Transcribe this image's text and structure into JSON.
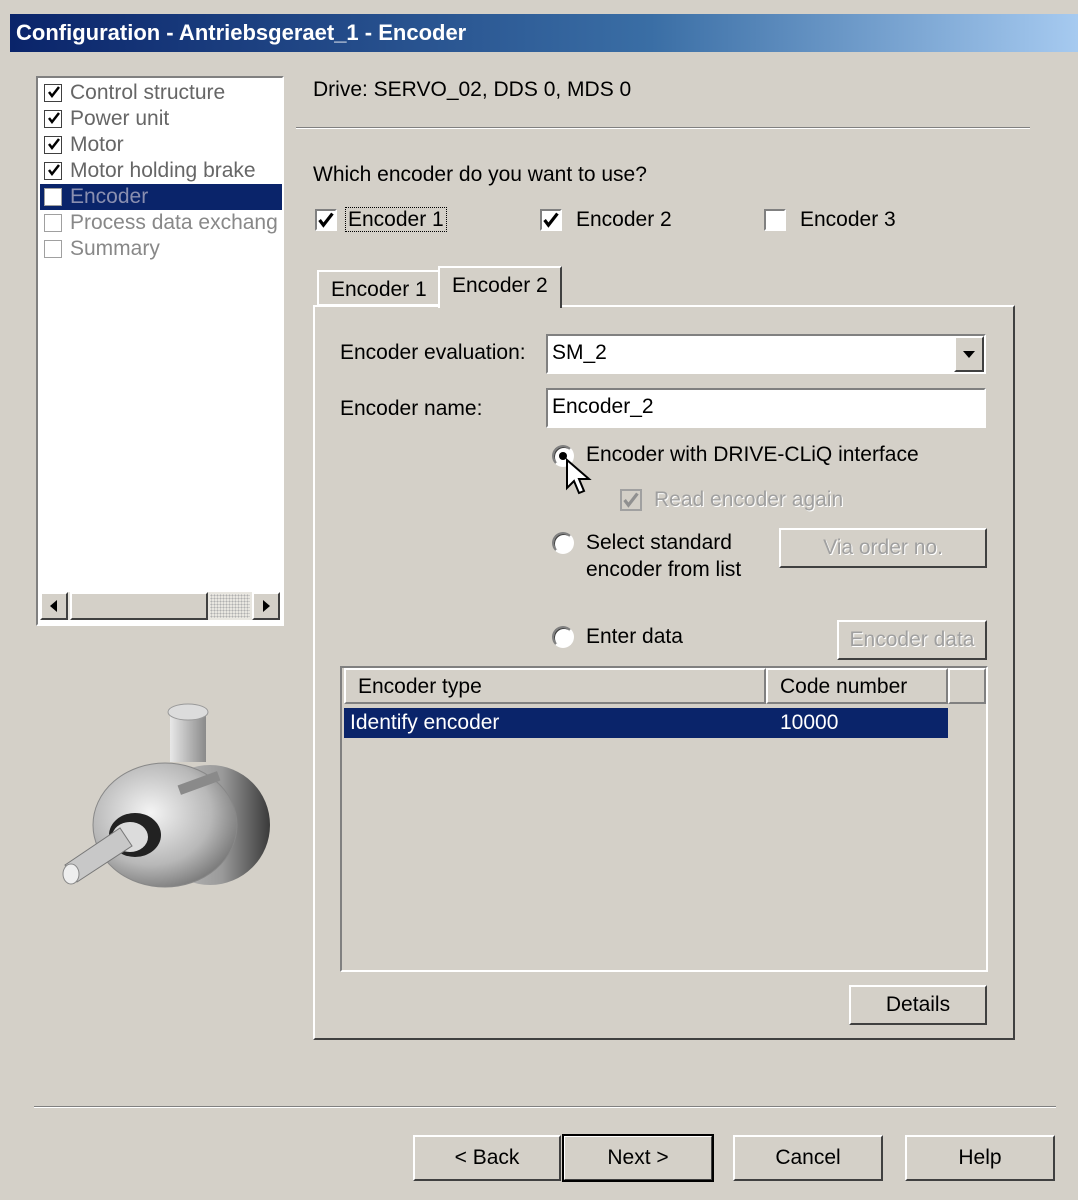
{
  "window": {
    "title": "Configuration - Antriebsgeraet_1 - Encoder"
  },
  "nav": {
    "items": [
      {
        "label": "Control structure",
        "checked": true,
        "selected": false
      },
      {
        "label": "Power unit",
        "checked": true,
        "selected": false
      },
      {
        "label": "Motor",
        "checked": true,
        "selected": false
      },
      {
        "label": "Motor holding brake",
        "checked": true,
        "selected": false
      },
      {
        "label": "Encoder",
        "checked": false,
        "selected": true
      },
      {
        "label": "Process data exchang",
        "checked": false,
        "selected": false
      },
      {
        "label": "Summary",
        "checked": false,
        "selected": false
      }
    ]
  },
  "drive": {
    "label": "Drive: SERVO_02, DDS 0, MDS 0"
  },
  "encoder_choice": {
    "question": "Which encoder do you want to use?",
    "options": [
      {
        "label": "Encoder 1",
        "checked": true
      },
      {
        "label": "Encoder 2",
        "checked": true
      },
      {
        "label": "Encoder 3",
        "checked": false
      }
    ]
  },
  "tabs": [
    {
      "label": "Encoder 1",
      "active": false
    },
    {
      "label": "Encoder 2",
      "active": true
    }
  ],
  "panel": {
    "evaluation_label": "Encoder evaluation:",
    "evaluation_value": "SM_2",
    "name_label": "Encoder name:",
    "name_value": "Encoder_2",
    "radio_drivecliq": "Encoder with DRIVE-CLiQ interface",
    "read_again": "Read encoder again",
    "radio_standard_line1": "Select standard",
    "radio_standard_line2": "encoder from list",
    "via_order_btn": "Via order no.",
    "radio_enter": "Enter data",
    "encoder_data_btn": "Encoder data",
    "details_btn": "Details"
  },
  "table": {
    "columns": [
      "Encoder type",
      "Code number"
    ],
    "rows": [
      {
        "type": "Identify encoder",
        "code": "10000"
      }
    ]
  },
  "footer": {
    "back": "< Back",
    "next": "Next >",
    "cancel": "Cancel",
    "help": "Help"
  },
  "icons": {
    "checkbox_mark": "check-mark-icon",
    "dropdown": "chevron-down-icon",
    "scroll_left": "arrow-left-icon",
    "scroll_right": "arrow-right-icon",
    "cursor": "mouse-pointer-icon",
    "illustration": "rotary-encoder-image"
  },
  "colors": {
    "title_bar_start": "#0a246a",
    "title_bar_end": "#a6caf0",
    "face": "#d4d0c8",
    "selection": "#0a246a"
  }
}
